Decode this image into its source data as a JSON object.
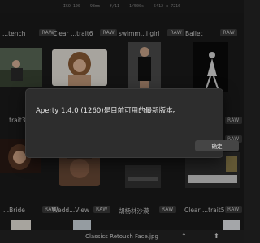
{
  "window": {
    "exif": [
      "ISO 100",
      "98mm",
      "f/11",
      "1/500s",
      "5412 x 7216"
    ]
  },
  "grid": {
    "badge": "RAW",
    "rows": [
      [
        "...tench",
        "Clear ...trait6",
        "swimm...i girl",
        "Ballet"
      ],
      [
        "...trait3",
        "",
        "",
        ""
      ],
      [
        "...Bride",
        "Wedd...View",
        "胡杨林沙漠",
        "Clear ...trait5"
      ]
    ]
  },
  "dialog": {
    "message": "Aperty 1.4.0 (1260)是目前可用的最新版本。",
    "ok_label": "确定"
  },
  "bottombar": {
    "filename": "Classics Retouch Face.jpg"
  },
  "colors": {
    "background": "#1b1b1b",
    "dialog": "#2d2d2d",
    "badge": "#3a3a3a"
  },
  "icons": {
    "bottom_left": "up-arrow-icon",
    "bottom_right": "upload-icon"
  }
}
